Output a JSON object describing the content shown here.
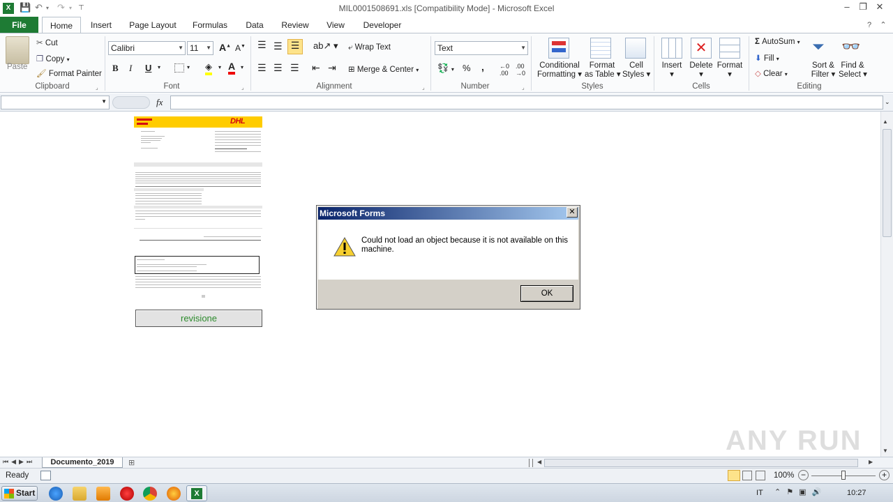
{
  "window": {
    "title": "MIL0001508691.xls  [Compatibility Mode]  -  Microsoft Excel"
  },
  "tabs": [
    "File",
    "Home",
    "Insert",
    "Page Layout",
    "Formulas",
    "Data",
    "Review",
    "View",
    "Developer"
  ],
  "ribbon": {
    "clipboard": {
      "label": "Clipboard",
      "paste": "Paste",
      "cut": "Cut",
      "copy": "Copy",
      "format_painter": "Format Painter"
    },
    "font": {
      "label": "Font",
      "name": "Calibri",
      "size": "11",
      "bold": "B",
      "italic": "I",
      "underline": "U"
    },
    "alignment": {
      "label": "Alignment",
      "wrap_text": "Wrap Text",
      "merge_center": "Merge & Center"
    },
    "number": {
      "label": "Number",
      "format": "Text",
      "percent": "%",
      "comma": ","
    },
    "styles": {
      "label": "Styles",
      "conditional": "Conditional",
      "conditional2": "Formatting",
      "format_as": "Format",
      "format_as2": "as Table",
      "cell": "Cell",
      "cell2": "Styles"
    },
    "cells": {
      "label": "Cells",
      "insert": "Insert",
      "delete": "Delete",
      "format": "Format"
    },
    "editing": {
      "label": "Editing",
      "autosum": "AutoSum",
      "fill": "Fill",
      "clear": "Clear",
      "sort": "Sort &",
      "sort2": "Filter",
      "find": "Find &",
      "find2": "Select"
    }
  },
  "formula_bar": {
    "name_box": "",
    "fx": "fx",
    "content": ""
  },
  "document": {
    "brand": "DHL",
    "button_label": "revisione"
  },
  "dialog": {
    "title": "Microsoft Forms",
    "message": "Could not load an object because it is not available on this machine.",
    "ok": "OK",
    "close": "✕"
  },
  "sheet_tabs": {
    "active": "Documento_2019"
  },
  "status": {
    "ready": "Ready",
    "zoom": "100%"
  },
  "taskbar": {
    "start": "Start",
    "lang": "IT",
    "time": "10:27"
  },
  "watermark": "ANY RUN",
  "colors": {
    "file_tab": "#1e7b34",
    "dhl_yellow": "#ffcc00",
    "dhl_red": "#d40511",
    "dialog_title": "#0a246a"
  }
}
